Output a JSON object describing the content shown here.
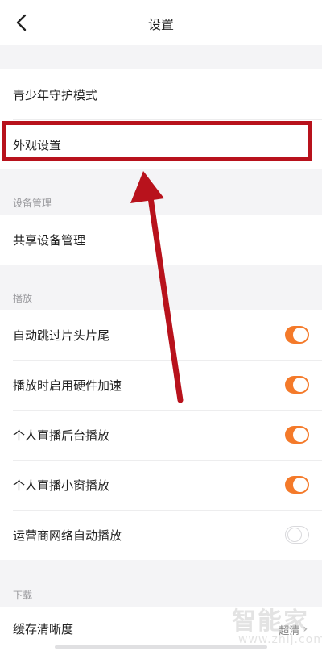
{
  "header": {
    "title": "设置"
  },
  "group_top": {
    "items": [
      {
        "label": "青少年守护模式"
      },
      {
        "label": "外观设置"
      }
    ]
  },
  "section_device": {
    "label": "设备管理"
  },
  "group_device": {
    "items": [
      {
        "label": "共享设备管理"
      }
    ]
  },
  "section_play": {
    "label": "播放"
  },
  "group_play": {
    "items": [
      {
        "label": "自动跳过片头片尾",
        "toggle_on": true
      },
      {
        "label": "播放时启用硬件加速",
        "toggle_on": true
      },
      {
        "label": "个人直播后台播放",
        "toggle_on": true
      },
      {
        "label": "个人直播小窗播放",
        "toggle_on": true
      },
      {
        "label": "运营商网络自动播放",
        "toggle_on": false
      }
    ]
  },
  "section_download": {
    "label": "下载"
  },
  "group_download": {
    "items": [
      {
        "label": "缓存清晰度",
        "value": "超清"
      }
    ]
  },
  "watermark": {
    "brand": "智能家",
    "url": "www.zhij.com"
  },
  "colors": {
    "accent": "#f47a2a",
    "annotation": "#b8121c"
  }
}
